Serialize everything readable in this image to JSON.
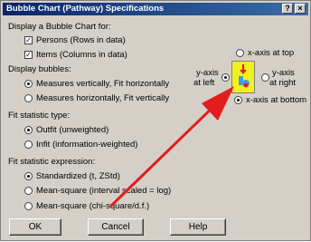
{
  "window": {
    "title": "Bubble Chart (Pathway) Specifications",
    "close_glyph": "×",
    "help_glyph": "?"
  },
  "display_for": {
    "heading": "Display a Bubble Chart for:",
    "persons": "Persons (Rows in data)",
    "items": "Items (Columns in data)"
  },
  "display_bubbles": {
    "heading": "Display bubbles:",
    "vertical": "Measures vertically, Fit horizontally",
    "horizontal": "Measures horizontally, Fit vertically"
  },
  "fit_type": {
    "heading": "Fit statistic type:",
    "outfit": "Outfit (unweighted)",
    "infit": "Infit (information-weighted)"
  },
  "fit_expr": {
    "heading": "Fit statistic expression:",
    "standardized": "Standardized (t, ZStd)",
    "mean_square_log": "Mean-square (interval scaled = log)",
    "mean_square_chi": "Mean-square (chi-square/d.f.)"
  },
  "axes": {
    "x_top": "x-axis at top",
    "y_left_line1": "y-axis",
    "y_left_line2": "at left",
    "y_right_line1": "y-axis",
    "y_right_line2": "at right",
    "x_bottom": "x-axis at bottom"
  },
  "buttons": {
    "ok": "OK",
    "cancel": "Cancel",
    "help": "Help"
  },
  "colors": {
    "arrow": "#e21d1d",
    "preview": "#f4ef1e",
    "title_bar": "#0a246a"
  }
}
